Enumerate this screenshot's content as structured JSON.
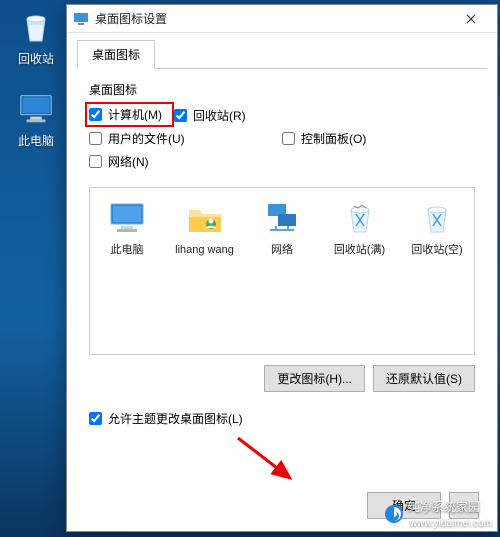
{
  "desktop": {
    "recycle_bin": "回收站",
    "this_pc": "此电脑"
  },
  "dialog": {
    "title": "桌面图标设置",
    "tab": "桌面图标",
    "group_label": "桌面图标",
    "checks": {
      "computer": "计算机(M)",
      "recycle_bin": "回收站(R)",
      "user_files": "用户的文件(U)",
      "control_panel": "控制面板(O)",
      "network": "网络(N)"
    },
    "icons": {
      "this_pc": "此电脑",
      "user": "lihang wang",
      "network": "网络",
      "bin_full": "回收站(满)",
      "bin_empty": "回收站(空)"
    },
    "change_icon": "更改图标(H)...",
    "restore_default": "还原默认值(S)",
    "allow_themes": "允许主题更改桌面图标(L)",
    "ok": "确定"
  },
  "watermark": {
    "brand": "纯净系统家园",
    "url": "www.yidaimei.com"
  }
}
